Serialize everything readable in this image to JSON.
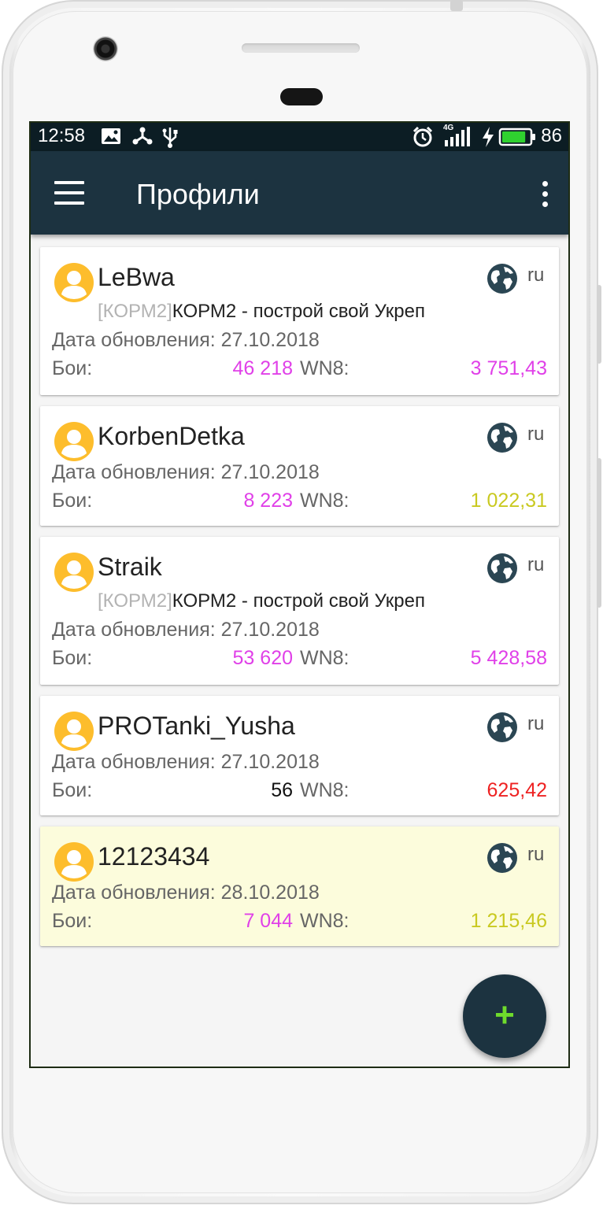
{
  "status_bar": {
    "time": "12:58",
    "network": "4G",
    "battery_percent": "86",
    "battery_level": 0.86,
    "battery_color": "#2fd12f"
  },
  "app_bar": {
    "title": "Профили",
    "menu_icon": "hamburger-menu-icon",
    "more_icon": "more-vertical-icon"
  },
  "labels": {
    "updated": "Дата обновления:",
    "battles": "Бои:",
    "wn8": "WN8:"
  },
  "colors": {
    "app_bar": "#1c3340",
    "avatar": "#fdbd2c",
    "globe": "#2b4653",
    "battles": "#e040e8",
    "highlight": "#fcfcdc"
  },
  "profiles": [
    {
      "name": "LeBwa",
      "region": "ru",
      "clan_tag": "[КОРМ2]",
      "clan_name": "КОРМ2 - построй свой Укреп",
      "updated": "27.10.2018",
      "battles": "46 218",
      "wn8": "3 751,43",
      "wn8_color": "#e040e8",
      "highlighted": false
    },
    {
      "name": "KorbenDetka",
      "region": "ru",
      "clan_tag": "",
      "clan_name": "",
      "updated": "27.10.2018",
      "battles": "8 223",
      "wn8": "1 022,31",
      "wn8_color": "#c9c920",
      "highlighted": false
    },
    {
      "name": "Straik",
      "region": "ru",
      "clan_tag": "[КОРМ2]",
      "clan_name": "КОРМ2 - построй свой Укреп",
      "updated": "27.10.2018",
      "battles": "53 620",
      "wn8": "5 428,58",
      "wn8_color": "#e040e8",
      "highlighted": false
    },
    {
      "name": "PROTanki_Yusha",
      "region": "ru",
      "clan_tag": "",
      "clan_name": "",
      "updated": "27.10.2018",
      "battles": "56",
      "battles_color": "#111111",
      "wn8": "625,42",
      "wn8_color": "#ee2222",
      "highlighted": false
    },
    {
      "name": "12123434",
      "region": "ru",
      "clan_tag": "",
      "clan_name": "",
      "updated": "28.10.2018",
      "battles": "7 044",
      "wn8": "1 215,46",
      "wn8_color": "#c9c920",
      "highlighted": true
    }
  ],
  "fab": {
    "label": "+",
    "icon": "plus-icon"
  }
}
